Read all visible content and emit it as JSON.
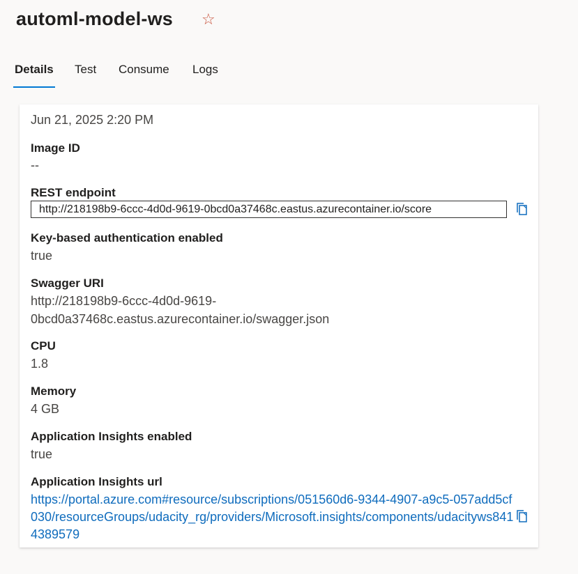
{
  "header": {
    "title": "automl-model-ws",
    "favorite_icon": "star-outline-icon"
  },
  "tabs": [
    {
      "label": "Details",
      "active": true
    },
    {
      "label": "Test",
      "active": false
    },
    {
      "label": "Consume",
      "active": false
    },
    {
      "label": "Logs",
      "active": false
    }
  ],
  "details": {
    "created_on_value": "Jun 21, 2025 2:20 PM",
    "image_id": {
      "label": "Image ID",
      "value": "--"
    },
    "rest_endpoint": {
      "label": "REST endpoint",
      "value": "http://218198b9-6ccc-4d0d-9619-0bcd0a37468c.eastus.azurecontainer.io/score",
      "copy_icon": "copy-icon"
    },
    "key_auth": {
      "label": "Key-based authentication enabled",
      "value": "true"
    },
    "swagger_uri": {
      "label": "Swagger URI",
      "value_line1": "http://218198b9-6ccc-4d0d-9619-",
      "value_line2": "0bcd0a37468c.eastus.azurecontainer.io/swagger.json"
    },
    "cpu": {
      "label": "CPU",
      "value": "1.8"
    },
    "memory": {
      "label": "Memory",
      "value": "4 GB"
    },
    "app_insights_enabled": {
      "label": "Application Insights enabled",
      "value": "true"
    },
    "app_insights_url": {
      "label": "Application Insights url",
      "value": "https://portal.azure.com#resource/subscriptions/051560d6-9344-4907-a9c5-057add5cf030/resourceGroups/udacity_rg/providers/Microsoft.insights/components/udacityws8414389579",
      "copy_icon": "copy-icon"
    }
  },
  "colors": {
    "accent": "#0078d4",
    "link": "#0f6cbd",
    "star": "#c8533c",
    "background": "#faf9f8"
  }
}
